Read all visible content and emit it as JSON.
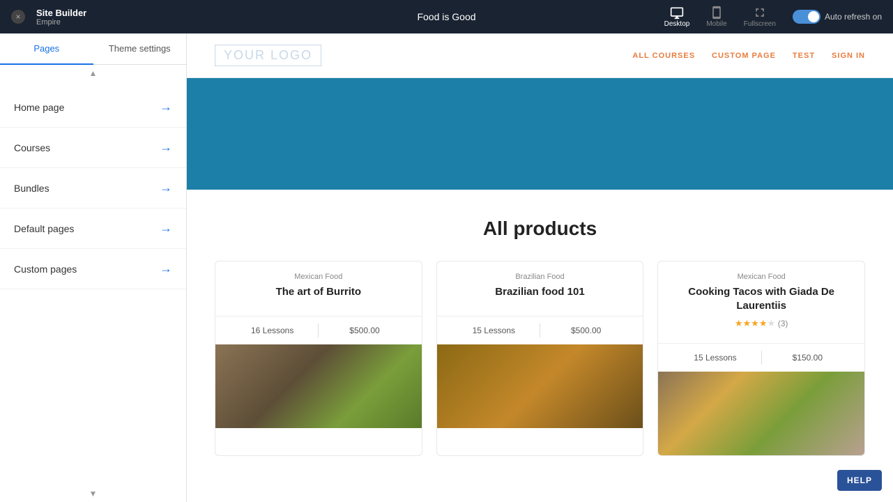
{
  "topbar": {
    "close_icon": "×",
    "app_name": "Site Builder",
    "app_sub": "Empire",
    "page_title": "Food is Good",
    "desktop_label": "Desktop",
    "mobile_label": "Mobile",
    "fullscreen_label": "Fullscreen",
    "auto_refresh_label": "Auto refresh on"
  },
  "sidebar": {
    "tab_pages": "Pages",
    "tab_theme": "Theme settings",
    "items": [
      {
        "label": "Home page"
      },
      {
        "label": "Courses"
      },
      {
        "label": "Bundles"
      },
      {
        "label": "Default pages"
      },
      {
        "label": "Custom pages"
      }
    ]
  },
  "preview": {
    "logo": "YOUR LOGO",
    "nav_items": [
      "ALL COURSES",
      "CUSTOM PAGE",
      "TEST",
      "SIGN IN"
    ],
    "products_title": "All products",
    "products": [
      {
        "category": "Mexican Food",
        "name": "The art of Burrito",
        "lessons": "16 Lessons",
        "price": "$500.00",
        "stars": 0,
        "star_count": null
      },
      {
        "category": "Brazilian Food",
        "name": "Brazilian food 101",
        "lessons": "15 Lessons",
        "price": "$500.00",
        "stars": 0,
        "star_count": null
      },
      {
        "category": "Mexican Food",
        "name": "Cooking Tacos with Giada De Laurentiis",
        "lessons": "15 Lessons",
        "price": "$150.00",
        "stars": 4,
        "star_count": "(3)"
      }
    ]
  },
  "help": {
    "label": "HELP"
  }
}
